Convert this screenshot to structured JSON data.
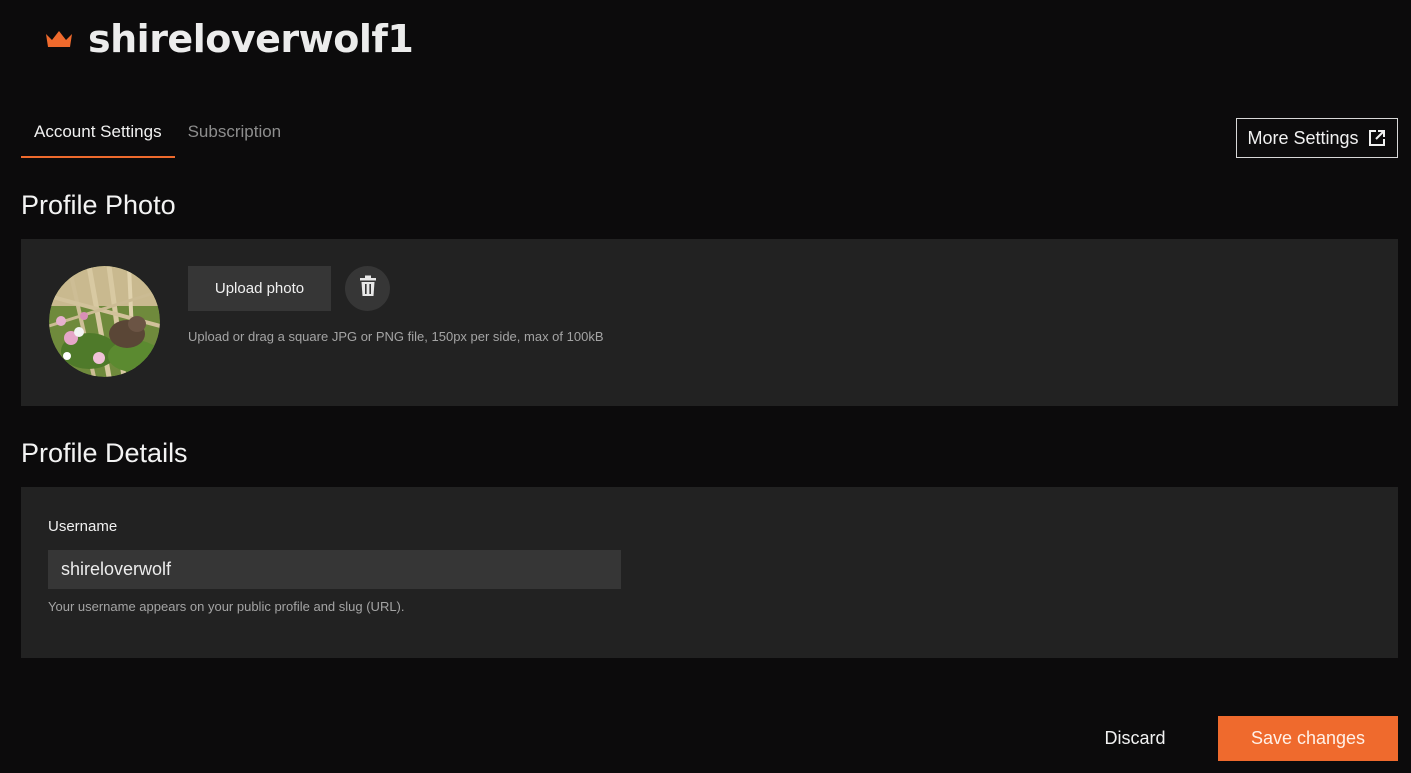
{
  "header": {
    "username_title": "shireloverwolf1",
    "crown_color": "#ef6a2d"
  },
  "tabs": [
    {
      "label": "Account Settings",
      "active": true
    },
    {
      "label": "Subscription",
      "active": false
    }
  ],
  "more_settings": {
    "label": "More Settings",
    "icon": "external-link-icon"
  },
  "profile_photo": {
    "section_title": "Profile Photo",
    "upload_label": "Upload photo",
    "delete_icon": "trash-icon",
    "hint": "Upload or drag a square JPG or PNG file, 150px per side, max of 100kB"
  },
  "profile_details": {
    "section_title": "Profile Details",
    "username_label": "Username",
    "username_value": "shireloverwolf",
    "username_help": "Your username appears on your public profile and slug (URL)."
  },
  "actions": {
    "discard_label": "Discard",
    "save_label": "Save changes"
  },
  "colors": {
    "accent": "#ef6a2d",
    "panel": "#222222",
    "background": "#0c0b0c"
  }
}
